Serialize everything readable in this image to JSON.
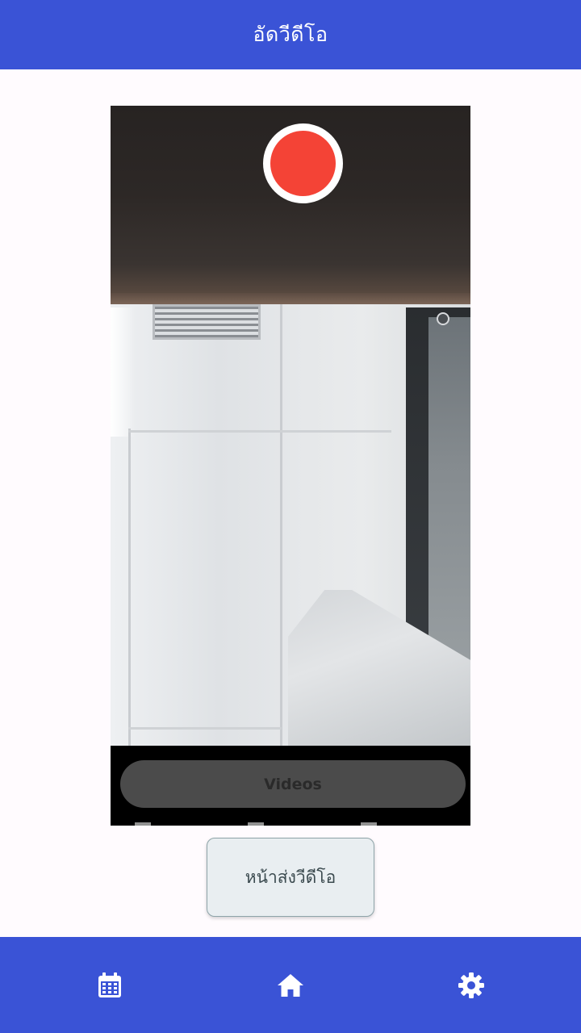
{
  "app_bar": {
    "title": "อัดวีดีโอ"
  },
  "camera": {
    "record_button_color": "#f44336",
    "videos_label": "Videos"
  },
  "actions": {
    "send_video_label": "หน้าส่งวีดีโอ"
  },
  "bottom_nav": {
    "items": [
      {
        "icon": "calendar-icon"
      },
      {
        "icon": "home-icon"
      },
      {
        "icon": "gear-icon"
      }
    ]
  },
  "colors": {
    "primary": "#3a53d6",
    "background": "#fffbfe",
    "record": "#f44336"
  }
}
